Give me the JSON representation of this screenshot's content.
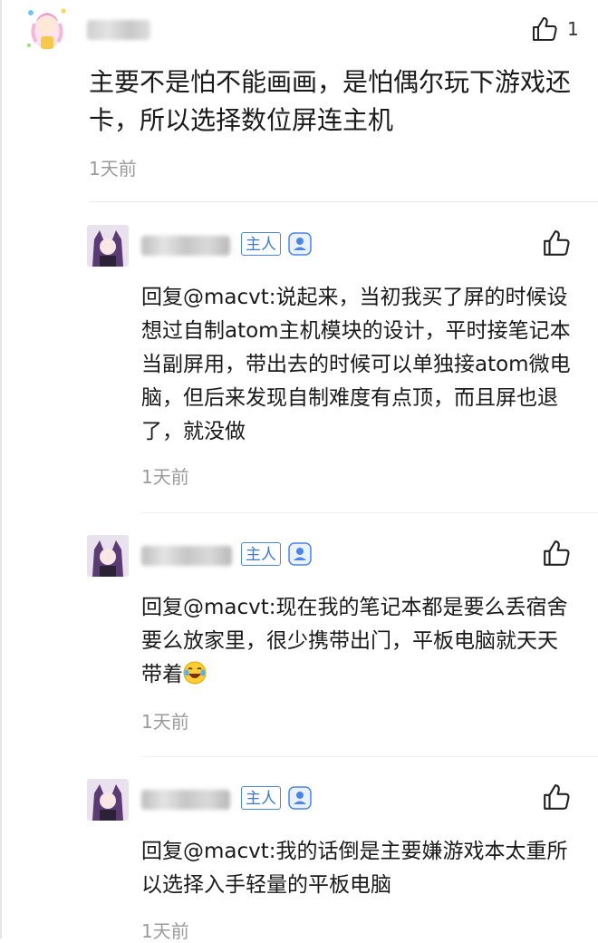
{
  "top_comment": {
    "like_count": "1",
    "text": "主要不是怕不能画画，是怕偶尔玩下游戏还卡，所以选择数位屏连主机",
    "time": "1天前"
  },
  "replies": [
    {
      "badge": "主人",
      "text": "回复@macvt:说起来，当初我买了屏的时候设想过自制atom主机模块的设计，平时接笔记本当副屏用，带出去的时候可以单独接atom微电脑，但后来发现自制难度有点顶，而且屏也退了，就没做",
      "time": "1天前"
    },
    {
      "badge": "主人",
      "text": "回复@macvt:现在我的笔记本都是要么丢宿舍要么放家里，很少携带出门，平板电脑就天天带着",
      "time": "1天前"
    },
    {
      "badge": "主人",
      "text": "回复@macvt:我的话倒是主要嫌游戏本太重所以选择入手轻量的平板电脑",
      "time": "1天前"
    }
  ],
  "icons": {
    "like": "thumbs-up-icon",
    "verified": "verified-user-icon",
    "emoji": "laughing-tears-emoji"
  },
  "colors": {
    "badge_blue": "#3a78e0",
    "time_gray": "#9b9b9b",
    "text": "#1a1a1a"
  }
}
